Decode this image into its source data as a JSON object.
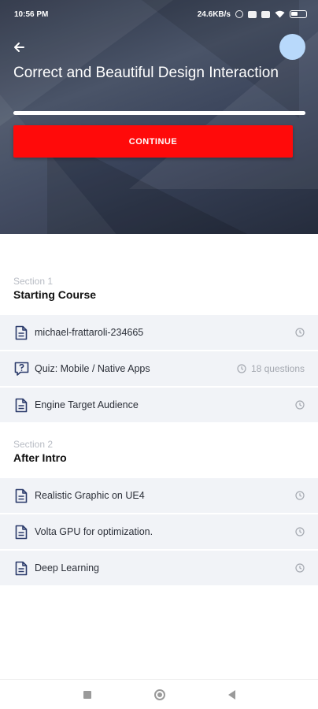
{
  "status_bar": {
    "time": "10:56 PM",
    "network_speed": "24.6KB/s",
    "battery_level": "56",
    "icons": [
      "alarm-icon",
      "sim-icon",
      "sim-icon",
      "wifi-icon",
      "battery-icon"
    ]
  },
  "header": {
    "back_icon": "arrow-left-icon",
    "course_title": "Correct and Beautiful Design Interaction",
    "progress_fraction": 1.0,
    "continue_label": "CONTINUE",
    "accent_color": "#ff0a0a",
    "avatar_color": "#b8d9fb"
  },
  "sections": [
    {
      "label": "Section 1",
      "title": "Starting Course",
      "lessons": [
        {
          "icon": "document-icon",
          "title": "michael-frattaroli-234665",
          "meta": ""
        },
        {
          "icon": "quiz-icon",
          "title": "Quiz: Mobile / Native Apps",
          "meta": "18 questions"
        },
        {
          "icon": "document-icon",
          "title": "Engine Target Audience",
          "meta": ""
        }
      ]
    },
    {
      "label": "Section 2",
      "title": "After Intro",
      "lessons": [
        {
          "icon": "document-icon",
          "title": "Realistic Graphic on UE4",
          "meta": ""
        },
        {
          "icon": "document-icon",
          "title": "Volta GPU for optimization.",
          "meta": ""
        },
        {
          "icon": "document-icon",
          "title": "Deep Learning",
          "meta": ""
        }
      ]
    }
  ],
  "nav_bar": {
    "buttons": [
      "recent-apps-icon",
      "home-icon",
      "back-icon"
    ]
  }
}
